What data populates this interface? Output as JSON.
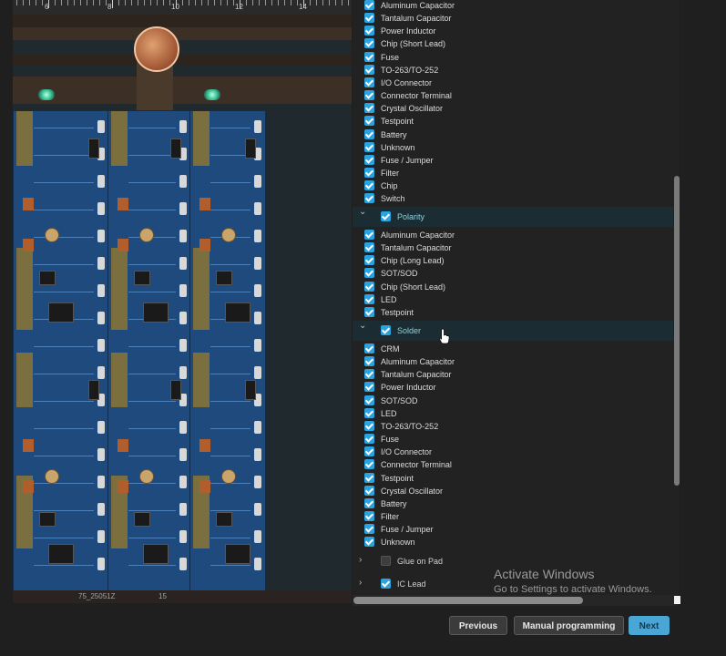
{
  "ruler": {
    "labels": [
      "6",
      "8",
      "10",
      "12",
      "14"
    ]
  },
  "board": {
    "bottom_left_text": "75_25051Z",
    "bottom_mid_text": "15"
  },
  "sections": [
    {
      "id": "top",
      "items": [
        "Aluminum Capacitor",
        "Tantalum Capacitor",
        "Power Inductor",
        "Chip (Short Lead)",
        "Fuse",
        "TO-263/TO-252",
        "I/O Connector",
        "Connector Terminal",
        "Crystal Oscillator",
        "Testpoint",
        "Battery",
        "Unknown",
        "Fuse / Jumper",
        "Filter",
        "Chip",
        "Switch"
      ]
    },
    {
      "id": "polarity",
      "label": "Polarity",
      "expanded": true,
      "checked": true,
      "items": [
        "Aluminum Capacitor",
        "Tantalum Capacitor",
        "Chip (Long Lead)",
        "SOT/SOD",
        "Chip (Short Lead)",
        "LED",
        "Testpoint"
      ]
    },
    {
      "id": "solder",
      "label": "Solder",
      "expanded": true,
      "checked": true,
      "items": [
        "CRM",
        "Aluminum Capacitor",
        "Tantalum Capacitor",
        "Power Inductor",
        "SOT/SOD",
        "LED",
        "TO-263/TO-252",
        "Fuse",
        "I/O Connector",
        "Connector Terminal",
        "Testpoint",
        "Crystal Oscillator",
        "Battery",
        "Filter",
        "Fuse / Jumper",
        "Unknown"
      ]
    },
    {
      "id": "glue",
      "label": "Glue on Pad",
      "expanded": false,
      "checked": false
    },
    {
      "id": "ic",
      "label": "IC Lead",
      "expanded": false,
      "checked": true
    }
  ],
  "watermark": {
    "title": "Activate Windows",
    "subtitle": "Go to Settings to activate Windows."
  },
  "buttons": {
    "previous": "Previous",
    "manual": "Manual programming",
    "next": "Next"
  },
  "colors": {
    "accent": "#2ba3e0",
    "next_button": "#4aa6d4",
    "group_highlight": "#1b2d33"
  },
  "icons": {
    "expanded": "chevron-down-icon",
    "collapsed": "chevron-right-icon",
    "check": "checkbox-checked-icon"
  }
}
